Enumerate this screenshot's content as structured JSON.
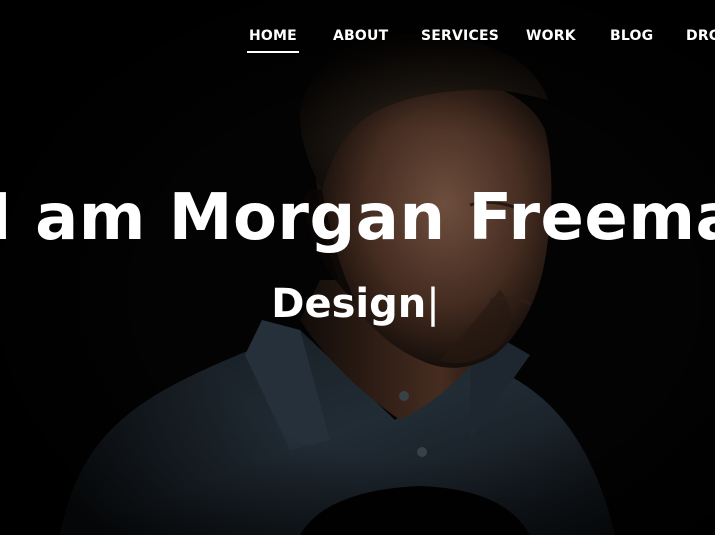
{
  "nav": {
    "items": [
      {
        "label": "HOME",
        "active": true
      },
      {
        "label": "ABOUT",
        "active": false
      },
      {
        "label": "SERVICES",
        "active": false
      },
      {
        "label": "WORK",
        "active": false
      },
      {
        "label": "BLOG",
        "active": false
      },
      {
        "label": "DRC",
        "active": false
      }
    ]
  },
  "hero": {
    "headline": "I am Morgan Freeman",
    "typed_word": "Design",
    "cursor": "|"
  },
  "colors": {
    "background": "#060606",
    "text": "#ffffff",
    "denim_shirt": "#2e3c48"
  }
}
